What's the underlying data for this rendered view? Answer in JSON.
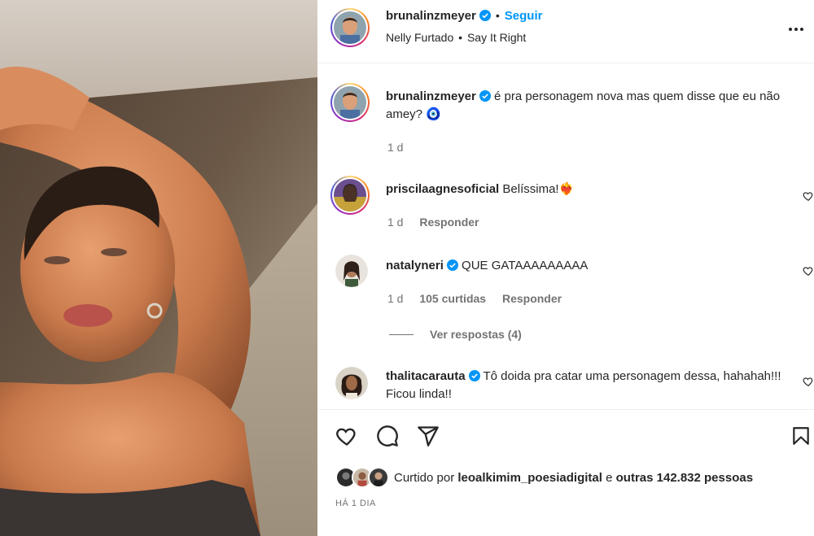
{
  "post": {
    "author": "brunalinzmeyer",
    "follow_label": "Seguir",
    "separator": "•",
    "music_artist": "Nelly Furtado",
    "music_song": "Say It Right",
    "more_icon": "more-horizontal-icon"
  },
  "caption": {
    "user": "brunalinzmeyer",
    "text": "é pra personagem nova mas quem disse que eu não amey? 🧿",
    "time": "1 d"
  },
  "comments": [
    {
      "user": "priscilaagnesoficial",
      "text": "Belíssima!❤️‍🔥",
      "time": "1 d",
      "reply_label": "Responder"
    },
    {
      "user": "natalyneri",
      "text": "QUE GATAAAAAAAAA",
      "time": "1 d",
      "likes": "105 curtidas",
      "reply_label": "Responder",
      "view_replies": "Ver respostas (4)"
    },
    {
      "user": "thalitacarauta",
      "text": "Tô doida pra catar uma personagem dessa, hahahah!!! Ficou linda!!"
    }
  ],
  "likes": {
    "prefix": "Curtido por",
    "user": "leoalkimim_poesiadigital",
    "connector": "e",
    "others": "outras 142.832 pessoas"
  },
  "date": "HÁ 1 DIA",
  "colors": {
    "accent": "#0095f6",
    "verified": "#0095f6",
    "text": "#262626",
    "muted": "#737373"
  },
  "icons": [
    "heart-icon",
    "comment-icon",
    "share-icon",
    "bookmark-icon",
    "verified-badge-icon"
  ]
}
